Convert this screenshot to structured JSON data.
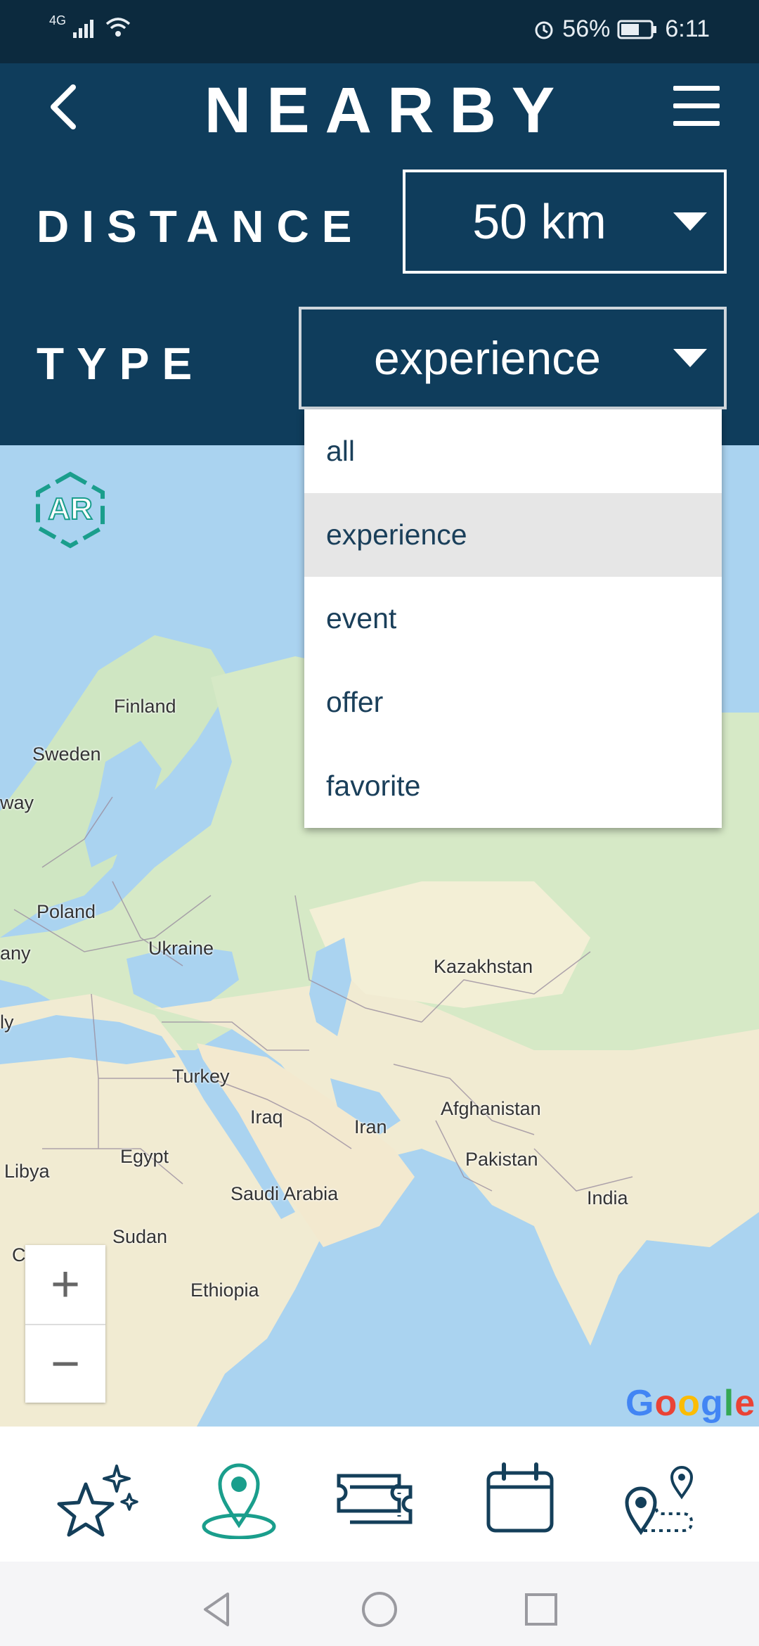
{
  "status_bar": {
    "network": "4G",
    "battery_percent": "56%",
    "time": "6:11",
    "icons": [
      "signal-icon",
      "wifi-icon",
      "alarm-icon",
      "battery-icon"
    ]
  },
  "header": {
    "title": "NEARBY",
    "back_icon": "chevron-left-icon",
    "menu_icon": "hamburger-menu-icon",
    "distance": {
      "label": "DISTANCE",
      "value": "50 km"
    },
    "type": {
      "label": "TYPE",
      "value": "experience"
    }
  },
  "type_dropdown": {
    "options": [
      "all",
      "experience",
      "event",
      "offer",
      "favorite"
    ],
    "selected": "experience"
  },
  "map": {
    "ar_button_label": "AR",
    "places": [
      "Finland",
      "Sweden",
      "way",
      "Poland",
      "any",
      "Ukraine",
      "Kazakhstan",
      "ly",
      "Turkey",
      "Iraq",
      "Iran",
      "Afghanistan",
      "Pakistan",
      "Libya",
      "Egypt",
      "Saudi Arabia",
      "India",
      "Sudan",
      "Chad",
      "Ethiopia"
    ],
    "zoom_in": "+",
    "zoom_out": "−",
    "attribution": "Google"
  },
  "bottom_nav": {
    "items": [
      {
        "icon": "star-sparkle-icon",
        "active": false
      },
      {
        "icon": "map-pin-icon",
        "active": true
      },
      {
        "icon": "ticket-icon",
        "active": false
      },
      {
        "icon": "calendar-icon",
        "active": false
      },
      {
        "icon": "route-icon",
        "active": false
      }
    ]
  },
  "colors": {
    "header_bg": "#0f3d5c",
    "status_bg": "#0c2a3e",
    "accent_teal": "#1a9e8c",
    "icon_navy": "#143f5a",
    "water": "#aad3f0",
    "land": "#cfe6c2"
  }
}
